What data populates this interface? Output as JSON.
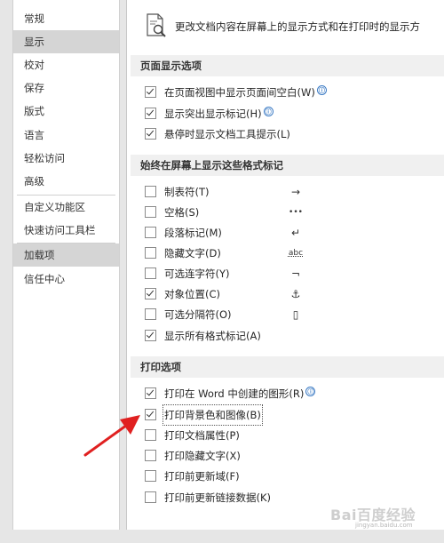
{
  "sidebar": {
    "items": [
      {
        "label": "常规"
      },
      {
        "label": "显示"
      },
      {
        "label": "校对"
      },
      {
        "label": "保存"
      },
      {
        "label": "版式"
      },
      {
        "label": "语言"
      },
      {
        "label": "轻松访问"
      },
      {
        "label": "高级"
      },
      {
        "label": "自定义功能区"
      },
      {
        "label": "快速访问工具栏"
      },
      {
        "label": "加载项"
      },
      {
        "label": "信任中心"
      }
    ],
    "selected": "显示"
  },
  "header": {
    "text": "更改文档内容在屏幕上的显示方式和在打印时的显示方"
  },
  "sections": {
    "page_display": {
      "title": "页面显示选项",
      "options": [
        {
          "label": "在页面视图中显示页面间空白(W)",
          "checked": true
        },
        {
          "label": "显示突出显示标记(H)",
          "checked": true
        },
        {
          "label": "悬停时显示文档工具提示(L)",
          "checked": true
        }
      ]
    },
    "format_marks": {
      "title": "始终在屏幕上显示这些格式标记",
      "options": [
        {
          "label": "制表符(T)",
          "checked": false,
          "symbol": "→"
        },
        {
          "label": "空格(S)",
          "checked": false,
          "symbol": "•••"
        },
        {
          "label": "段落标记(M)",
          "checked": false,
          "symbol": "↵"
        },
        {
          "label": "隐藏文字(D)",
          "checked": false,
          "symbol": "abc"
        },
        {
          "label": "可选连字符(Y)",
          "checked": false,
          "symbol": "¬"
        },
        {
          "label": "对象位置(C)",
          "checked": true,
          "symbol": "⚓"
        },
        {
          "label": "可选分隔符(O)",
          "checked": false,
          "symbol": "▯"
        },
        {
          "label": "显示所有格式标记(A)",
          "checked": true
        }
      ]
    },
    "print": {
      "title": "打印选项",
      "options": [
        {
          "label": "打印在 Word 中创建的图形(R)",
          "checked": true
        },
        {
          "label": "打印背景色和图像(B)",
          "checked": true
        },
        {
          "label": "打印文档属性(P)",
          "checked": false
        },
        {
          "label": "打印隐藏文字(X)",
          "checked": false
        },
        {
          "label": "打印前更新域(F)",
          "checked": false
        },
        {
          "label": "打印前更新链接数据(K)",
          "checked": false
        }
      ]
    }
  },
  "info_icon": "ⓘ",
  "annotation_arrow_color": "#e02020",
  "watermark": {
    "text": "Bai百度经验",
    "sub": "jingyan.baidu.com"
  }
}
